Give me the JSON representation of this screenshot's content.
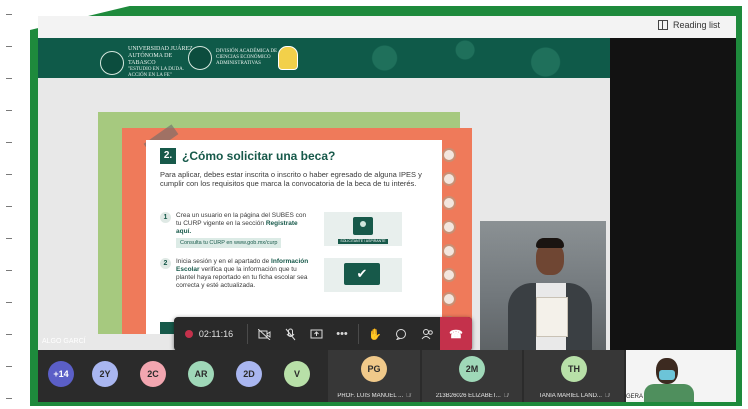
{
  "browser": {
    "reading_list_label": "Reading list"
  },
  "slide": {
    "university_logo_text": "UNIVERSIDAD JUÁREZ AUTÓNOMA DE TABASCO",
    "university_motto": "\"ESTUDIO EN LA DUDA. ACCIÓN EN LA FE\"",
    "division_logo_text": "DIVISIÓN ACADÉMICA DE CIENCIAS ECONÓMICO ADMINISTRATIVAS",
    "step_number": "2.",
    "title": "¿Cómo solicitar una beca?",
    "intro": "Para aplicar, debes estar inscrita o inscrito o haber egresado de alguna IPES y cumplir con los requisitos que marca la convocatoria de la beca de tu interés.",
    "steps": [
      {
        "num": "1",
        "text_a": "Crea un usuario en la página del SUBES con tu CURP vigente en la sección",
        "link": "Registrate aquí.",
        "note": "Consulta tu CURP en www.gob.mx/curp"
      },
      {
        "num": "2",
        "text_a": "Inicia sesión y en el apartado de",
        "bold": "Información Escolar",
        "text_b": "verifica que la información que tu plantel haya reportado en tu ficha escolar sea correcta y esté actualizada."
      }
    ],
    "card_ribbon": "SOLICITANTE / ASPIRANTE"
  },
  "meeting": {
    "elapsed_time": "02:11:16",
    "speaker_name_partial": "ALGO GARCÍ",
    "overflow_count": "+14",
    "avatars": [
      {
        "initials": "2Y",
        "color": "#a9b6f0"
      },
      {
        "initials": "2C",
        "color": "#f2a6b0"
      },
      {
        "initials": "AR",
        "color": "#9fd8b8"
      },
      {
        "initials": "2D",
        "color": "#a9b6f0"
      },
      {
        "initials": "V",
        "color": "#b8e0a8"
      }
    ],
    "tiles": [
      {
        "initials": "PG",
        "color": "#f0c98a",
        "name": "PROF. LUIS MANUEL ..."
      },
      {
        "initials": "2M",
        "color": "#9fd8b8",
        "name": "213B26026 ELIZABET..."
      },
      {
        "initials": "TH",
        "color": "#b8e0a8",
        "name": "TANIA MARIEL LAND..."
      }
    ],
    "self_name_partial": "GERA",
    "colors": {
      "recording": "#c4314b",
      "hangup": "#c4314b",
      "frame": "#1e8a3c"
    }
  }
}
